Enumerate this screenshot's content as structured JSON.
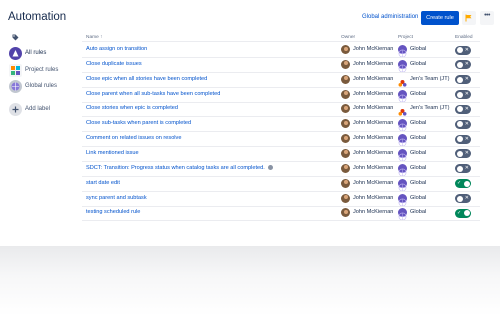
{
  "header": {
    "title": "Automation",
    "global_admin_label": "Global administration",
    "create_rule_label": "Create rule",
    "more_label": "•••"
  },
  "sidebar": {
    "items": [
      {
        "label": "All rules",
        "icon": "all-rules-icon",
        "active": true
      },
      {
        "label": "Project rules",
        "icon": "project-rules-icon",
        "active": false
      },
      {
        "label": "Global rules",
        "icon": "global-rules-icon",
        "active": false
      },
      {
        "label": "Add label",
        "icon": "add-label-icon",
        "active": false
      }
    ]
  },
  "table": {
    "columns": {
      "name": "Name ↑",
      "owner": "Owner",
      "project": "Project",
      "enabled": "Enabled"
    },
    "rows": [
      {
        "name": "Auto assign on transition",
        "owner": "John McKiernan",
        "project": "Global",
        "project_type": "global",
        "enabled": false,
        "info": false
      },
      {
        "name": "Close duplicate issues",
        "owner": "John McKiernan",
        "project": "Global",
        "project_type": "global",
        "enabled": false,
        "info": false
      },
      {
        "name": "Close epic when all stories have been completed",
        "owner": "John McKiernan",
        "project": "Jen's Team (JT)",
        "project_type": "team",
        "enabled": false,
        "info": false
      },
      {
        "name": "Close parent when all sub-tasks have been completed",
        "owner": "John McKiernan",
        "project": "Global",
        "project_type": "global",
        "enabled": false,
        "info": false
      },
      {
        "name": "Close stories when epic is completed",
        "owner": "John McKiernan",
        "project": "Jen's Team (JT)",
        "project_type": "team",
        "enabled": false,
        "info": false
      },
      {
        "name": "Close sub-tasks when parent is completed",
        "owner": "John McKiernan",
        "project": "Global",
        "project_type": "global",
        "enabled": false,
        "info": false
      },
      {
        "name": "Comment on related issues on resolve",
        "owner": "John McKiernan",
        "project": "Global",
        "project_type": "global",
        "enabled": false,
        "info": false
      },
      {
        "name": "Link mentioned issue",
        "owner": "John McKiernan",
        "project": "Global",
        "project_type": "global",
        "enabled": false,
        "info": false
      },
      {
        "name": "SDCT: Transition: Progress status when catalog tasks are all completed.",
        "owner": "John McKiernan",
        "project": "Global",
        "project_type": "global",
        "enabled": false,
        "info": true
      },
      {
        "name": "start date edit",
        "owner": "John McKiernan",
        "project": "Global",
        "project_type": "global",
        "enabled": true,
        "info": false
      },
      {
        "name": "sync parent and subtask",
        "owner": "John McKiernan",
        "project": "Global",
        "project_type": "global",
        "enabled": false,
        "info": false
      },
      {
        "name": "testing scheduled rule",
        "owner": "John McKiernan",
        "project": "Global",
        "project_type": "global",
        "enabled": true,
        "info": false
      }
    ]
  },
  "colors": {
    "primary": "#0052cc",
    "toggle_on": "#00875a",
    "toggle_off": "#505f79",
    "text": "#172b4d",
    "flag": "#ffab00"
  }
}
